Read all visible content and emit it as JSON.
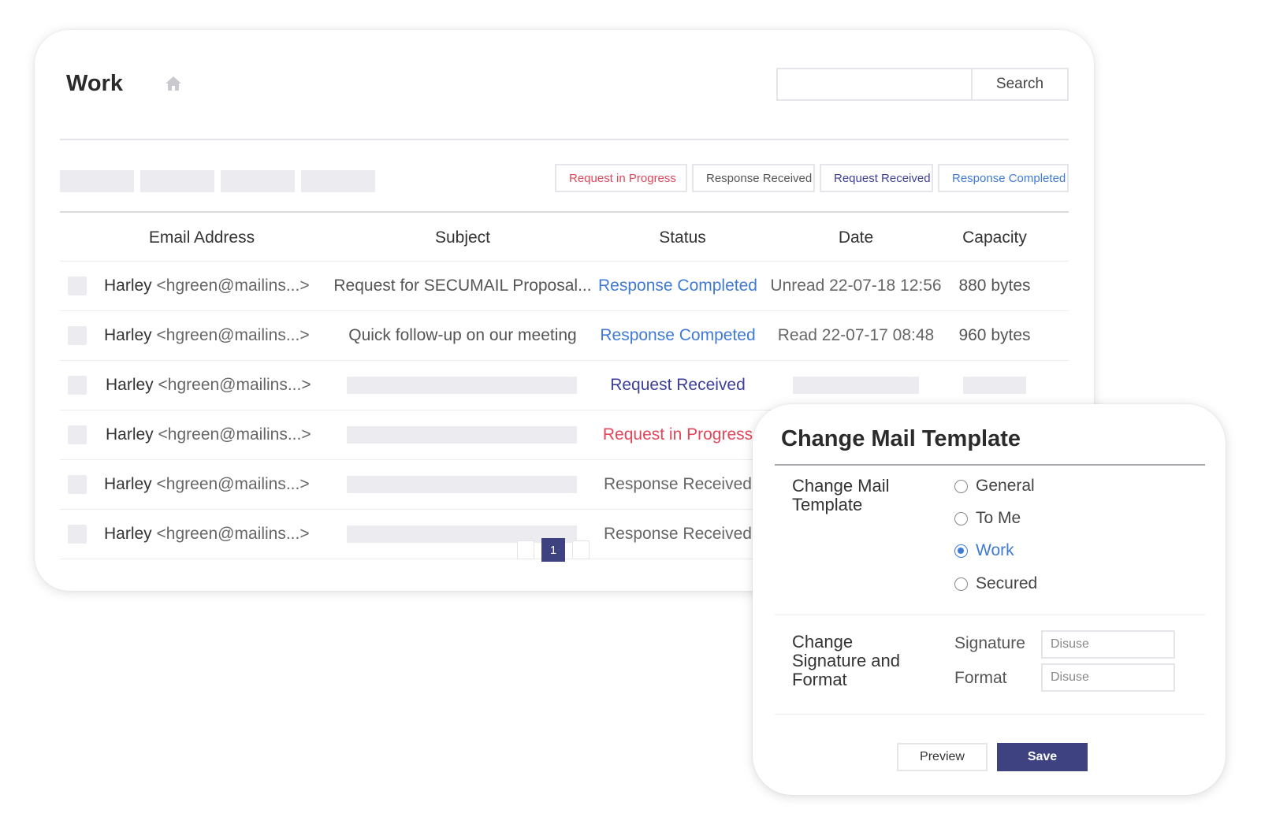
{
  "header": {
    "title": "Work",
    "search_placeholder": "",
    "search_label": "Search"
  },
  "filters": {
    "request_in_progress": "Request in Progress",
    "response_received": "Response Received",
    "request_received": "Request Received",
    "response_completed": "Response Completed"
  },
  "table": {
    "columns": [
      "Email Address",
      "Subject",
      "Status",
      "Date",
      "Capacity"
    ],
    "rows": [
      {
        "name": "Harley",
        "addr": "<hgreen@mailins...>",
        "subject": "Request for SECUMAIL Proposal...",
        "status": "Response Completed",
        "date": "Unread 22-07-18 12:56",
        "capacity": "880 bytes"
      },
      {
        "name": "Harley",
        "addr": "<hgreen@mailins...>",
        "subject": "Quick follow-up on our meeting",
        "status": "Response Competed",
        "date": "Read 22-07-17 08:48",
        "capacity": "960 bytes"
      },
      {
        "name": "Harley",
        "addr": "<hgreen@mailins...>",
        "subject": "",
        "status": "Request Received",
        "date": "",
        "capacity": ""
      },
      {
        "name": "Harley",
        "addr": "<hgreen@mailins...>",
        "subject": "",
        "status": "Request in Progress",
        "date": "",
        "capacity": ""
      },
      {
        "name": "Harley",
        "addr": "<hgreen@mailins...>",
        "subject": "",
        "status": "Response Received",
        "date": "",
        "capacity": ""
      },
      {
        "name": "Harley",
        "addr": "<hgreen@mailins...>",
        "subject": "",
        "status": "Response Received",
        "date": "",
        "capacity": ""
      }
    ]
  },
  "pagination": {
    "current_page": "1"
  },
  "modal": {
    "title": "Change Mail Template",
    "template_section_label": "Change Mail Template",
    "template_options": [
      "General",
      "To Me",
      "Work",
      "Secured"
    ],
    "selected_template": "Work",
    "signature_section_label": "Change Signature and Format",
    "signature_label": "Signature",
    "signature_value": "Disuse",
    "format_label": "Format",
    "format_value": "Disuse",
    "preview_label": "Preview",
    "save_label": "Save"
  },
  "colors": {
    "accent_navy": "#3e4281",
    "status_completed": "#3f7ad6",
    "status_request_received": "#3d3f9a",
    "status_in_progress": "#e0475a",
    "status_received": "#666666"
  }
}
